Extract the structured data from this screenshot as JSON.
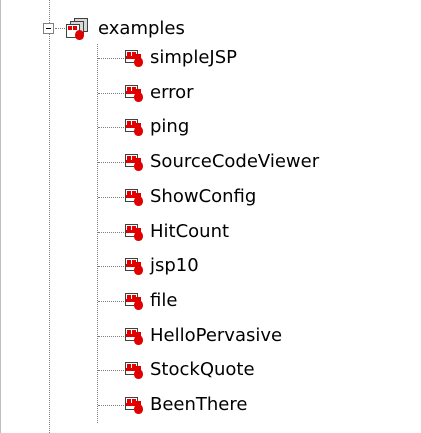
{
  "tree": {
    "root": {
      "label": "examples",
      "icon": "servlet-folder-icon",
      "expanded": true
    },
    "items": [
      {
        "label": "simpleJSP",
        "icon": "servlet-icon"
      },
      {
        "label": "error",
        "icon": "servlet-icon"
      },
      {
        "label": "ping",
        "icon": "servlet-icon"
      },
      {
        "label": "SourceCodeViewer",
        "icon": "servlet-icon"
      },
      {
        "label": "ShowConfig",
        "icon": "servlet-icon"
      },
      {
        "label": "HitCount",
        "icon": "servlet-icon"
      },
      {
        "label": "jsp10",
        "icon": "servlet-icon"
      },
      {
        "label": "file",
        "icon": "servlet-icon"
      },
      {
        "label": "HelloPervasive",
        "icon": "servlet-icon"
      },
      {
        "label": "StockQuote",
        "icon": "servlet-icon"
      },
      {
        "label": "BeenThere",
        "icon": "servlet-icon"
      }
    ]
  },
  "colors": {
    "icon_red": "#e00000",
    "tree_line": "#808080"
  }
}
